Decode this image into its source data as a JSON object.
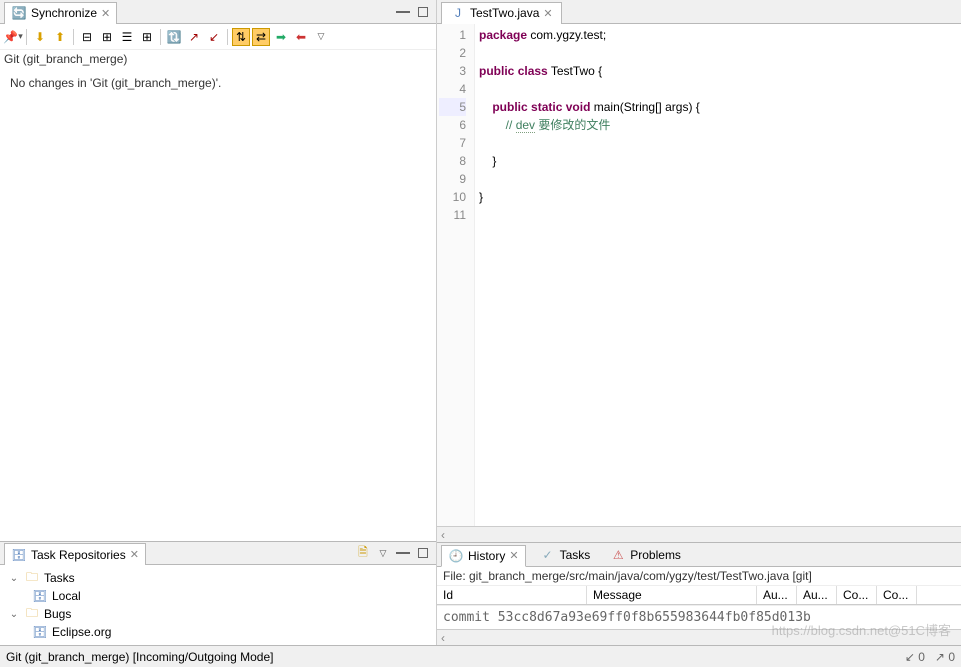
{
  "sync": {
    "title": "Synchronize",
    "repo": "Git (git_branch_merge)",
    "message": "No changes in 'Git (git_branch_merge)'."
  },
  "taskRepos": {
    "title": "Task Repositories",
    "items": [
      {
        "label": "Tasks",
        "children": [
          {
            "label": "Local"
          }
        ]
      },
      {
        "label": "Bugs",
        "children": [
          {
            "label": "Eclipse.org"
          }
        ]
      }
    ]
  },
  "editor": {
    "tab": "TestTwo.java",
    "lines": [
      {
        "n": 1,
        "kind": "pkg",
        "text": "package com.ygzy.test;"
      },
      {
        "n": 2,
        "kind": "blank",
        "text": ""
      },
      {
        "n": 3,
        "kind": "classdecl",
        "text": "public class TestTwo {"
      },
      {
        "n": 4,
        "kind": "blank",
        "text": ""
      },
      {
        "n": 5,
        "kind": "main",
        "text": "    public static void main(String[] args) {"
      },
      {
        "n": 6,
        "kind": "comment",
        "text": "        // dev 要修改的文件"
      },
      {
        "n": 7,
        "kind": "blank",
        "text": ""
      },
      {
        "n": 8,
        "kind": "plain",
        "text": "    }"
      },
      {
        "n": 9,
        "kind": "blank",
        "text": ""
      },
      {
        "n": 10,
        "kind": "plain",
        "text": "}"
      },
      {
        "n": 11,
        "kind": "blank",
        "text": ""
      }
    ]
  },
  "history": {
    "tabs": [
      "History",
      "Tasks",
      "Problems"
    ],
    "filePath": "File: git_branch_merge/src/main/java/com/ygzy/test/TestTwo.java [git]",
    "columns": [
      "Id",
      "Message",
      "Au...",
      "Au...",
      "Co...",
      "Co..."
    ],
    "commit": "commit 53cc8d67a93e69ff0f8b655983644fb0f85d013b"
  },
  "status": {
    "left": "Git (git_branch_merge) [Incoming/Outgoing Mode]",
    "rightIncoming": "0",
    "rightOutgoing": "0"
  },
  "watermark": "https://blog.csdn.net@51C博客"
}
